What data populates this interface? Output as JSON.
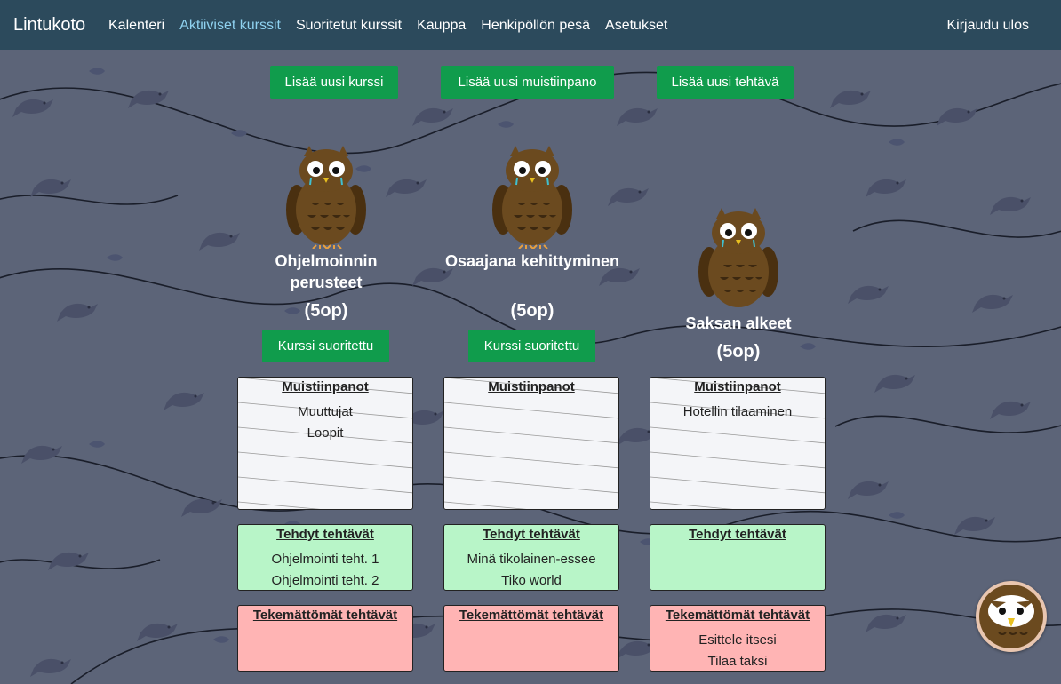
{
  "brand": "Lintukoto",
  "nav": {
    "items": [
      {
        "label": "Kalenteri",
        "active": false
      },
      {
        "label": "Aktiiviset kurssit",
        "active": true
      },
      {
        "label": "Suoritetut kurssit",
        "active": false
      },
      {
        "label": "Kauppa",
        "active": false
      },
      {
        "label": "Henkipöllön pesä",
        "active": false
      },
      {
        "label": "Asetukset",
        "active": false
      }
    ],
    "logout": "Kirjaudu ulos"
  },
  "actions": {
    "add_course": "Lisää uusi kurssi",
    "add_note": "Lisää uusi muistiinpano",
    "add_task": "Lisää uusi tehtävä"
  },
  "labels": {
    "complete_course": "Kurssi suoritettu",
    "notes": "Muistiinpanot",
    "done_tasks": "Tehdyt tehtävät",
    "todo_tasks": "Tekemättömät tehtävät"
  },
  "courses": [
    {
      "title": "Ohjelmoinnin perusteet",
      "credits": "(5op)",
      "notes": [
        "Muuttujat",
        "Loopit"
      ],
      "done": [
        "Ohjelmointi teht. 1",
        "Ohjelmointi teht. 2"
      ],
      "todo": []
    },
    {
      "title": "Osaajana kehittyminen",
      "credits": "(5op)",
      "notes": [],
      "done": [
        "Minä tikolainen-essee",
        "Tiko world"
      ],
      "todo": []
    },
    {
      "title": "Saksan alkeet",
      "credits": "(5op)",
      "notes": [
        "Hotellin tilaaminen"
      ],
      "done": [],
      "todo": [
        "Esittele itsesi",
        "Tilaa taksi"
      ]
    }
  ],
  "colors": {
    "navbar": "#2c4a5c",
    "nav_active": "#8fd2f0",
    "button_green": "#109c4c",
    "done_bg": "#b8f5c8",
    "todo_bg": "#ffb4b4",
    "owl_brown": "#6b4a1f"
  }
}
